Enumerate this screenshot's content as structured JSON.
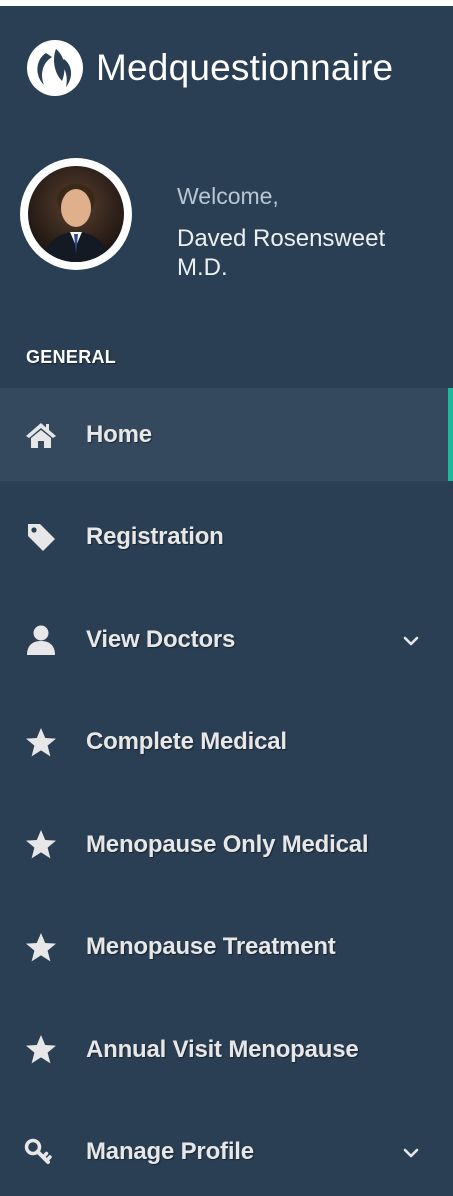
{
  "brand": {
    "title": "Medquestionnaire"
  },
  "profile": {
    "welcome": "Welcome,",
    "name": "Daved Rosensweet M.D."
  },
  "sidebar": {
    "section_label": "GENERAL",
    "items": [
      {
        "label": "Home",
        "icon": "home-icon",
        "active": true,
        "has_submenu": false
      },
      {
        "label": "Registration",
        "icon": "tag-icon",
        "active": false,
        "has_submenu": false
      },
      {
        "label": "View Doctors",
        "icon": "user-icon",
        "active": false,
        "has_submenu": true
      },
      {
        "label": "Complete Medical",
        "icon": "star-icon",
        "active": false,
        "has_submenu": false
      },
      {
        "label": "Menopause Only Medical",
        "icon": "star-icon",
        "active": false,
        "has_submenu": false
      },
      {
        "label": "Menopause Treatment",
        "icon": "star-icon",
        "active": false,
        "has_submenu": false
      },
      {
        "label": "Annual Visit Menopause",
        "icon": "star-icon",
        "active": false,
        "has_submenu": false
      },
      {
        "label": "Manage Profile",
        "icon": "key-icon",
        "active": false,
        "has_submenu": true
      }
    ]
  },
  "colors": {
    "background": "#2a3f54",
    "active_item": "#34495e",
    "active_indicator": "#1abb9c",
    "text": "#e7e7e7"
  }
}
